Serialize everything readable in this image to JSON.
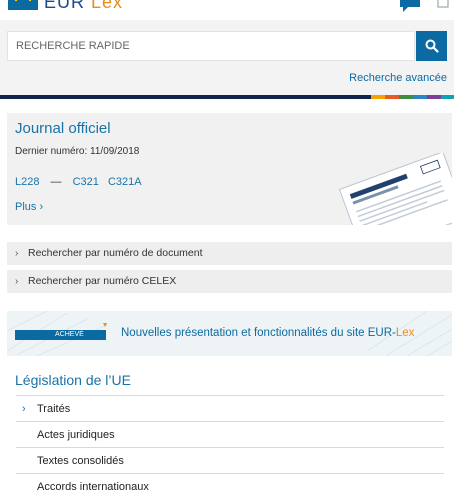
{
  "header": {
    "logo_text_a": "EUR",
    "logo_text_b": "Lex",
    "icons": [
      "eu-flag-icon",
      "chat-icon",
      "user-icon"
    ]
  },
  "search": {
    "placeholder": "RECHERCHE RAPIDE",
    "button_icon": "search-icon",
    "advanced_label": "Recherche avancée"
  },
  "journal": {
    "title": "Journal officiel",
    "latest_label": "Dernier numéro: 11/09/2018",
    "links": [
      "L228",
      "C321",
      "C321A"
    ],
    "separator": "—",
    "more_label": "Plus",
    "image_title": "Official Journal of the European Union"
  },
  "accordions": [
    {
      "label": "Rechercher par numéro de document"
    },
    {
      "label": "Rechercher par numéro CELEX"
    }
  ],
  "banner": {
    "tag": "ACHEVÉ",
    "text": "Nouvelles présentation et fonctionnalités du site ",
    "brand_a": "EUR-",
    "brand_b": "Lex"
  },
  "legislation": {
    "title": "Législation de l’UE",
    "items": [
      {
        "label": "Traités"
      },
      {
        "label": "Actes juridiques"
      },
      {
        "label": "Textes consolidés"
      },
      {
        "label": "Accords internationaux"
      }
    ]
  },
  "colors": {
    "accent": "#0b6aa2",
    "link": "#1a73a7",
    "stripe": "#11254b",
    "stripe_accents": [
      "#f4a300",
      "#e35b2b",
      "#3b8d3f",
      "#2a84c6",
      "#7c3f98",
      "#0fa3b1"
    ]
  }
}
